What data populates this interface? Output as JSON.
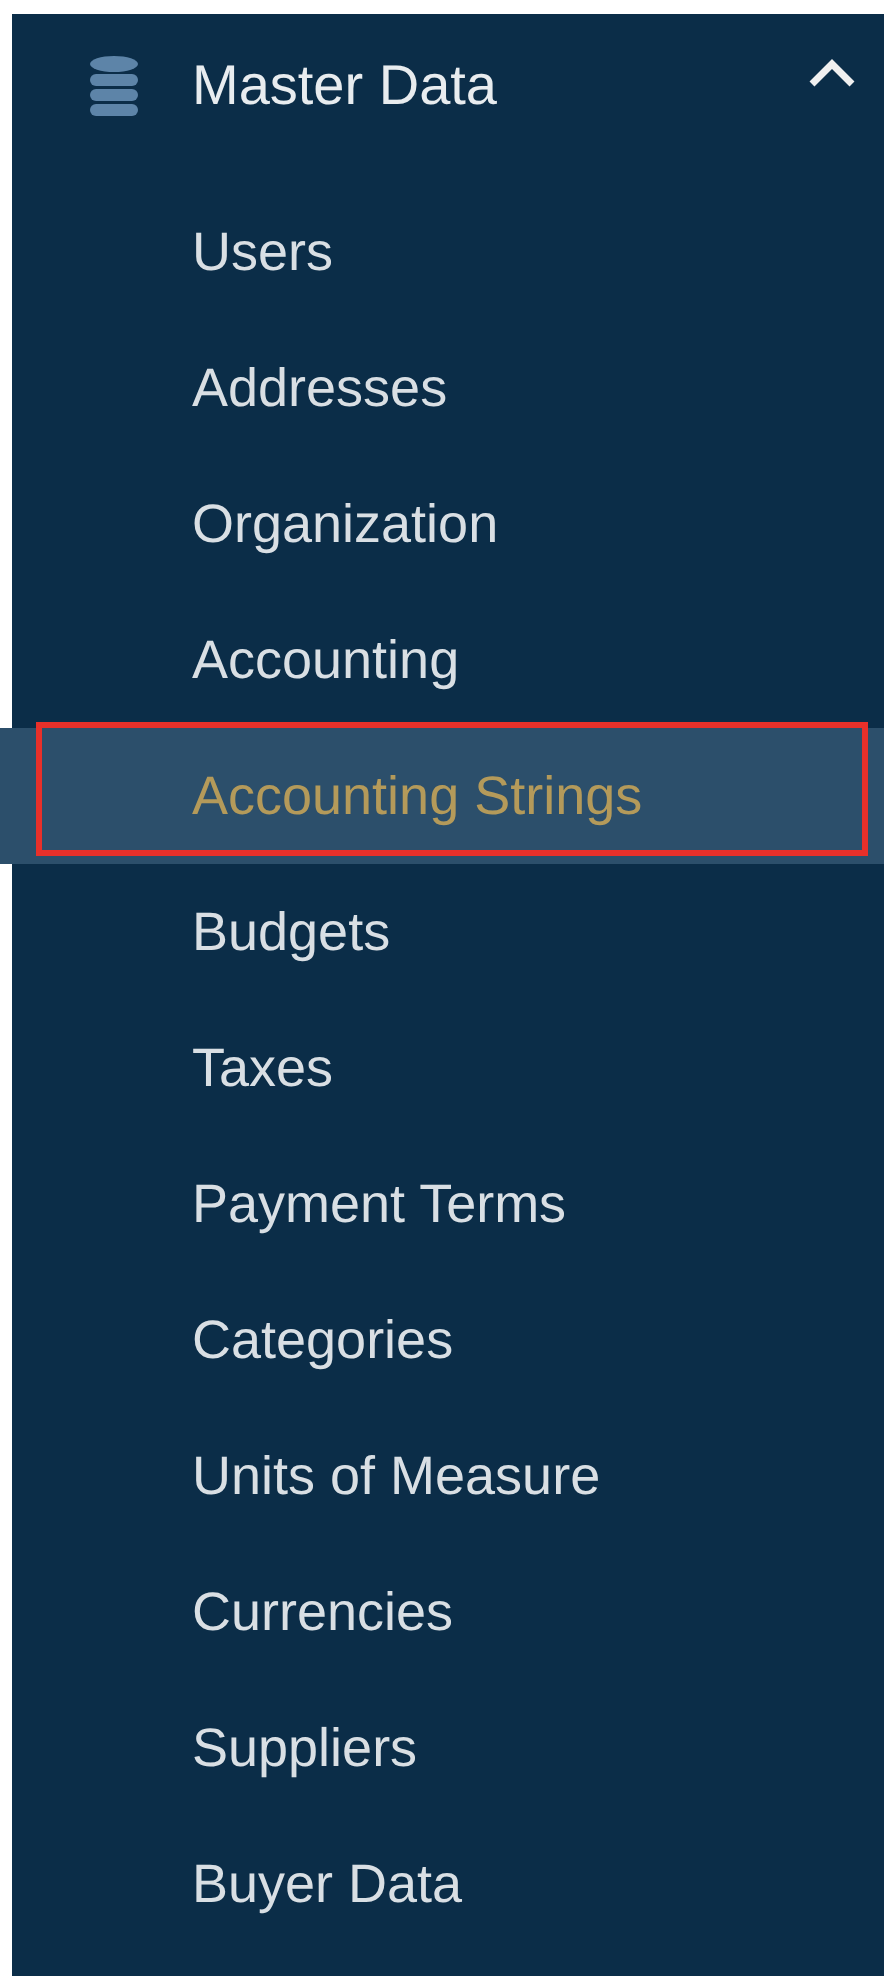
{
  "section": {
    "title": "Master Data",
    "expanded": true
  },
  "items": [
    {
      "label": "Users",
      "selected": false,
      "highlighted": false
    },
    {
      "label": "Addresses",
      "selected": false,
      "highlighted": false
    },
    {
      "label": "Organization",
      "selected": false,
      "highlighted": false
    },
    {
      "label": "Accounting",
      "selected": false,
      "highlighted": false
    },
    {
      "label": "Accounting Strings",
      "selected": true,
      "highlighted": true
    },
    {
      "label": "Budgets",
      "selected": false,
      "highlighted": false
    },
    {
      "label": "Taxes",
      "selected": false,
      "highlighted": false
    },
    {
      "label": "Payment Terms",
      "selected": false,
      "highlighted": false
    },
    {
      "label": "Categories",
      "selected": false,
      "highlighted": false
    },
    {
      "label": "Units of Measure",
      "selected": false,
      "highlighted": false
    },
    {
      "label": "Currencies",
      "selected": false,
      "highlighted": false
    },
    {
      "label": "Suppliers",
      "selected": false,
      "highlighted": false
    },
    {
      "label": "Buyer Data",
      "selected": false,
      "highlighted": false
    }
  ]
}
